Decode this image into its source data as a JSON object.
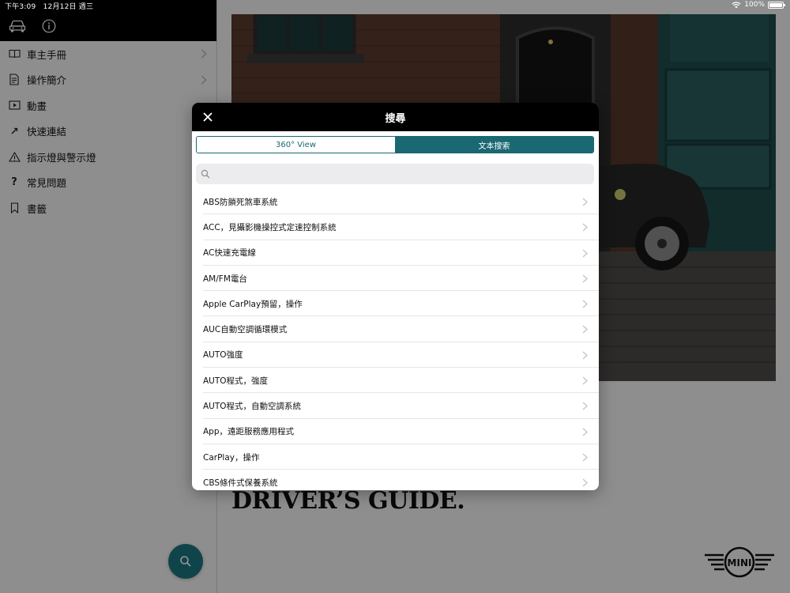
{
  "status_bar": {
    "time_date": "下午3:09　12月12日 週三",
    "battery": "100%",
    "battery_level": 1.0,
    "icons": [
      "wifi-icon",
      "battery-icon"
    ]
  },
  "sidebar": {
    "header_icons": [
      "car-icon",
      "info-icon"
    ],
    "items": [
      {
        "label": "車主手冊",
        "icon": "book-icon",
        "chevron": true
      },
      {
        "label": "操作簡介",
        "icon": "document-icon",
        "chevron": true
      },
      {
        "label": "動畫",
        "icon": "play-icon",
        "chevron": false
      },
      {
        "label": "快速連結",
        "icon": "link-icon",
        "chevron": false
      },
      {
        "label": "指示燈與警示燈",
        "icon": "warning-icon",
        "chevron": false
      },
      {
        "label": "常見問題",
        "icon": "question-icon",
        "chevron": false
      },
      {
        "label": "書籤",
        "icon": "bookmark-icon",
        "chevron": false
      }
    ],
    "fab_icon": "search-icon"
  },
  "main": {
    "guide_title": "DRIVER’S GUIDE.",
    "logo_text": "MINI"
  },
  "modal": {
    "title": "搜尋",
    "close_icon": "close-icon",
    "tabs": [
      {
        "label": "360° View",
        "active": false
      },
      {
        "label": "文本搜索",
        "active": true
      }
    ],
    "search": {
      "placeholder": "",
      "value": ""
    },
    "results": [
      "ABS防鎖死煞車系統",
      "ACC，見攝影機操控式定速控制系統",
      "AC快速充電線",
      "AM/FM電台",
      "Apple CarPlay預留，操作",
      "AUC自動空調循環模式",
      "AUTO強度",
      "AUTO程式，強度",
      "AUTO程式，自動空調系統",
      "App，遠距服務應用程式",
      "CarPlay，操作",
      "CBS條件式保養系統"
    ]
  },
  "colors": {
    "accent": "#1a6872",
    "header_bg": "#000000",
    "fab": "#1a7580"
  }
}
